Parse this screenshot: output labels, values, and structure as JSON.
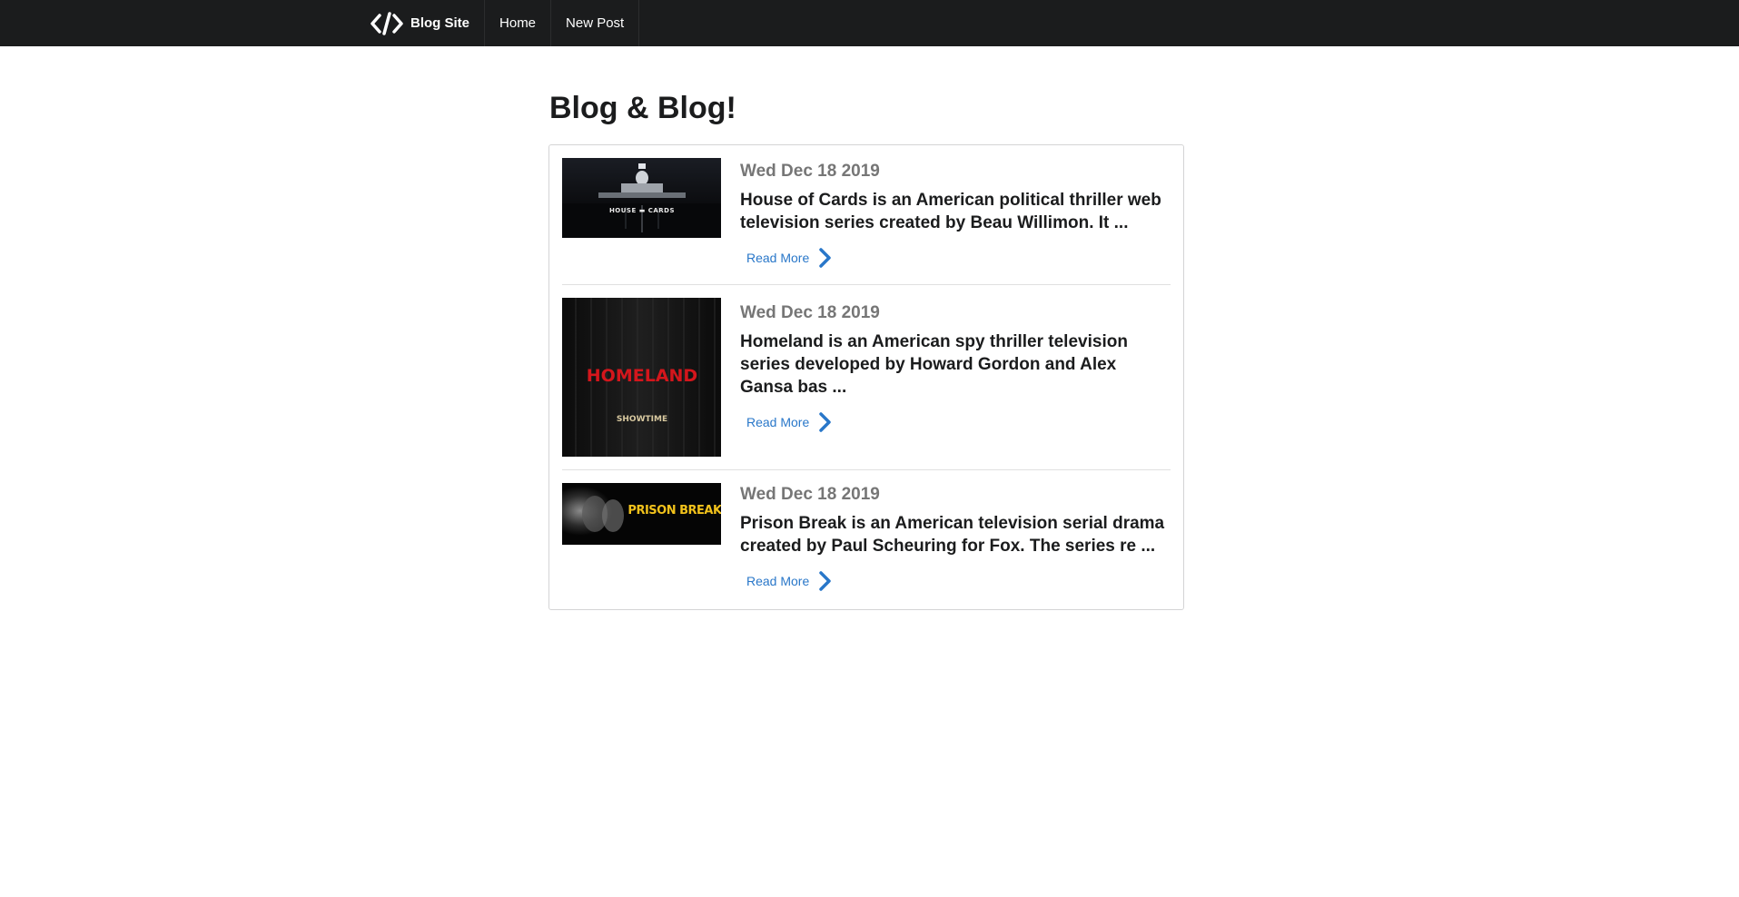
{
  "nav": {
    "brand": "Blog Site",
    "brand_icon": "code-icon",
    "items": [
      {
        "label": "Home"
      },
      {
        "label": "New Post"
      }
    ]
  },
  "page": {
    "title": "Blog & Blog!"
  },
  "posts": [
    {
      "date": "Wed Dec 18 2019",
      "excerpt": "House of Cards is an American political thriller web television series created by Beau Willimon. It ...",
      "read_more": "Read More",
      "image_text": "HOUSE ▬ CARDS"
    },
    {
      "date": "Wed Dec 18 2019",
      "excerpt": "Homeland is an American spy thriller television series developed by Howard Gordon and Alex Gansa bas ...",
      "read_more": "Read More",
      "image_text": "HOMELAND",
      "image_subtext": "SHOWTIME"
    },
    {
      "date": "Wed Dec 18 2019",
      "excerpt": "Prison Break is an American television serial drama created by Paul Scheuring for Fox. The series re ...",
      "read_more": "Read More",
      "image_text": "PRISON BREAK"
    }
  ],
  "colors": {
    "nav_bg": "#1b1c1d",
    "link": "#2977c9",
    "date": "#767676"
  }
}
